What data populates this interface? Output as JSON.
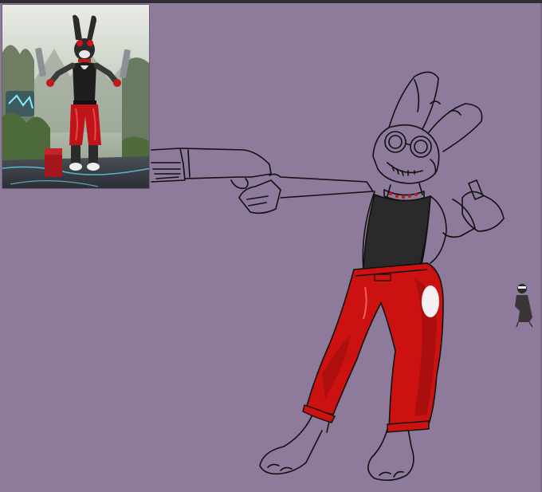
{
  "canvas": {
    "background": "#8e7a9b",
    "lineart_color": "#111111",
    "pants_color": "#cc1111",
    "shirt_color": "#2a2a2a"
  },
  "reference_image": {
    "description_icon": "reference-render-icon",
    "pants_color": "#c0131a",
    "shirt_color": "#1e1e1e",
    "fur_color": "#2b2b2b"
  },
  "thumbnail": {
    "icon": "small-figure-thumbnail-icon"
  }
}
